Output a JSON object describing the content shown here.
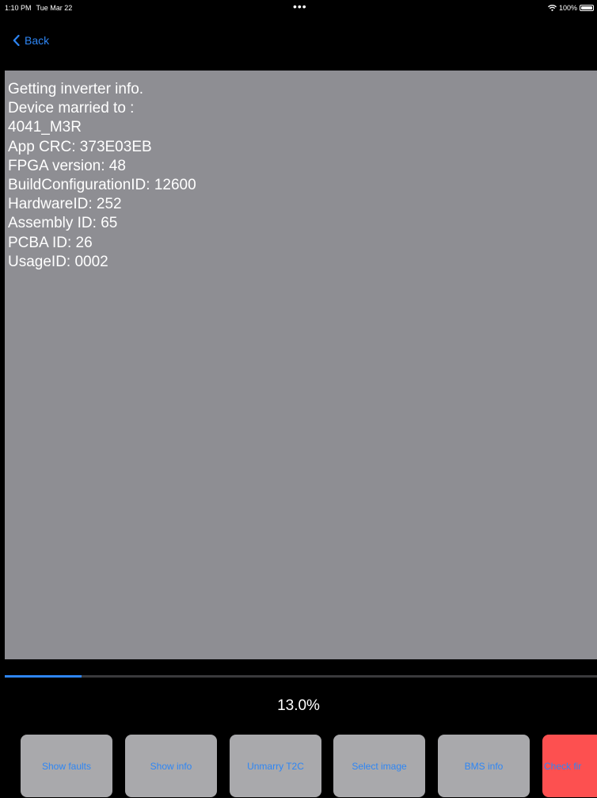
{
  "status_bar": {
    "time": "1:10 PM",
    "date": "Tue Mar 22",
    "center_dots": "•••",
    "battery": "100%",
    "icons": [
      "wifi-icon",
      "battery-icon"
    ]
  },
  "nav": {
    "back_label": "Back",
    "back_icon": "chevron-left-icon"
  },
  "info": {
    "lines": [
      "Getting inverter info.",
      "Device married to :",
      "4041_M3R",
      "App CRC: 373E03EB",
      "FPGA version: 48",
      "BuildConfigurationID: 12600",
      "HardwareID: 252",
      "Assembly ID: 65",
      "PCBA ID: 26",
      "UsageID: 0002"
    ]
  },
  "progress": {
    "value": 13.0,
    "label": "13.0%"
  },
  "buttons": [
    {
      "label": "Show faults"
    },
    {
      "label": "Show info"
    },
    {
      "label": "Unmarry T2C"
    },
    {
      "label": "Select image"
    },
    {
      "label": "BMS info"
    },
    {
      "label": "Check fir"
    }
  ],
  "colors": {
    "accent": "#2e86f5",
    "panel": "#8e8e93",
    "button": "#a9a9ac",
    "danger": "#fd5050"
  }
}
